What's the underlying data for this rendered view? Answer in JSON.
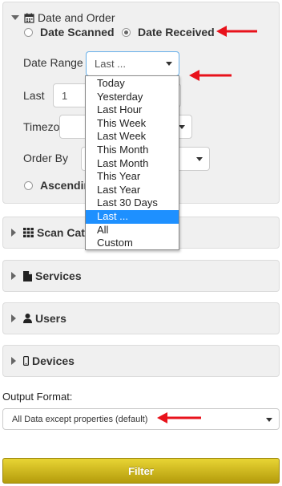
{
  "date_and_order": {
    "title": "Date and Order",
    "radio_date_scanned": "Date Scanned",
    "radio_date_received": "Date Received",
    "date_range_label": "Date Range",
    "date_range_value": "Last ...",
    "last_label": "Last",
    "last_value": "1",
    "timezone_label": "Timezone",
    "order_by_label": "Order By",
    "ascending_label": "Ascending",
    "date_range_options": [
      "Today",
      "Yesterday",
      "Last Hour",
      "This Week",
      "Last Week",
      "This Month",
      "Last Month",
      "This Year",
      "Last Year",
      "Last 30 Days",
      "Last ...",
      "All",
      "Custom"
    ],
    "selected_option": "Last ..."
  },
  "sections": {
    "scan_categories": "Scan Cate",
    "services": "Services",
    "users": "Users",
    "devices": "Devices"
  },
  "output": {
    "label": "Output Format:",
    "value": "All Data except properties (default)"
  },
  "filter_button": "Filter",
  "colors": {
    "annotation_arrow": "#e8121b",
    "selected_option": "#1e90ff",
    "filter_button_top": "#e8d434",
    "filter_button_bottom": "#b49c0c"
  },
  "icons": [
    "calendar-icon",
    "th-grid-icon",
    "file-icon",
    "user-icon",
    "mobile-icon",
    "caret-down-icon",
    "caret-right-icon"
  ]
}
